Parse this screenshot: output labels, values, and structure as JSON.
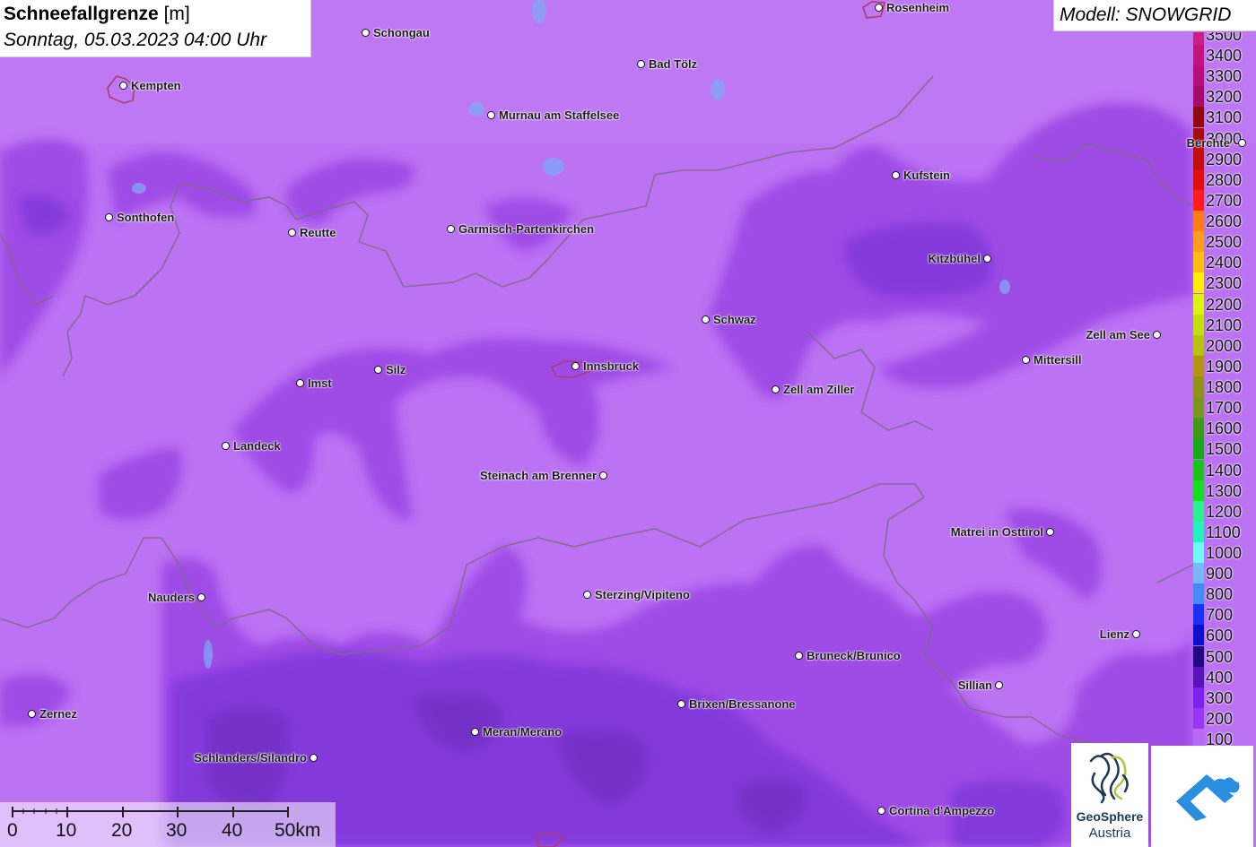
{
  "title": {
    "main": "Schneefallgrenze",
    "unit": "[m]",
    "date": "Sonntag, 05.03.2023 04:00 Uhr"
  },
  "model": "Modell: SNOWGRID",
  "legend": [
    {
      "label": "3500",
      "color": "#ca1f86"
    },
    {
      "label": "3400",
      "color": "#c4137f"
    },
    {
      "label": "3300",
      "color": "#b80e79"
    },
    {
      "label": "3200",
      "color": "#a60a6c"
    },
    {
      "label": "3100",
      "color": "#8e0a0e"
    },
    {
      "label": "3000",
      "color": "#a50c0c"
    },
    {
      "label": "2900",
      "color": "#c20e0e"
    },
    {
      "label": "2800",
      "color": "#e00f0f"
    },
    {
      "label": "2700",
      "color": "#ff1e1e"
    },
    {
      "label": "2600",
      "color": "#ff7d14"
    },
    {
      "label": "2500",
      "color": "#ff9e1a"
    },
    {
      "label": "2400",
      "color": "#ffbe0d"
    },
    {
      "label": "2300",
      "color": "#ffee00"
    },
    {
      "label": "2200",
      "color": "#dcf50f"
    },
    {
      "label": "2100",
      "color": "#c5df0c"
    },
    {
      "label": "2000",
      "color": "#b5c40a"
    },
    {
      "label": "1900",
      "color": "#b39310"
    },
    {
      "label": "1800",
      "color": "#949117"
    },
    {
      "label": "1700",
      "color": "#7c961a"
    },
    {
      "label": "1600",
      "color": "#3c9a15"
    },
    {
      "label": "1500",
      "color": "#19a81a"
    },
    {
      "label": "1400",
      "color": "#18c41a"
    },
    {
      "label": "1300",
      "color": "#14e01c"
    },
    {
      "label": "1200",
      "color": "#2af090"
    },
    {
      "label": "1100",
      "color": "#20f5bf"
    },
    {
      "label": "1000",
      "color": "#6ffaf6"
    },
    {
      "label": "900",
      "color": "#7ab9f7"
    },
    {
      "label": "800",
      "color": "#3f8cf5"
    },
    {
      "label": "700",
      "color": "#1a30f5"
    },
    {
      "label": "600",
      "color": "#0c10c9"
    },
    {
      "label": "500",
      "color": "#1d0a84"
    },
    {
      "label": "400",
      "color": "#5a12b9"
    },
    {
      "label": "300",
      "color": "#7d20f0"
    },
    {
      "label": "200",
      "color": "#9a36f5"
    },
    {
      "label": "100",
      "color": "#b76af5"
    }
  ],
  "cities": [
    {
      "name": "Rosenheim"
    },
    {
      "name": "Schongau"
    },
    {
      "name": "Kempten"
    },
    {
      "name": "Bad Tölz"
    },
    {
      "name": "Murnau am Staffelsee"
    },
    {
      "name": "Berchte"
    },
    {
      "name": "Kufstein"
    },
    {
      "name": "Sonthofen"
    },
    {
      "name": "Reutte"
    },
    {
      "name": "Garmisch-Partenkirchen"
    },
    {
      "name": "Kitzbühel"
    },
    {
      "name": "Schwaz"
    },
    {
      "name": "Zell am See"
    },
    {
      "name": "Mittersill"
    },
    {
      "name": "Silz"
    },
    {
      "name": "Innsbruck"
    },
    {
      "name": "Imst"
    },
    {
      "name": "Zell am Ziller"
    },
    {
      "name": "Landeck"
    },
    {
      "name": "Steinach am Brenner"
    },
    {
      "name": "Matrei in Osttirol"
    },
    {
      "name": "Nauders"
    },
    {
      "name": "Sterzing/Vipiteno"
    },
    {
      "name": "Lienz"
    },
    {
      "name": "Bruneck/Brunico"
    },
    {
      "name": "Sillian"
    },
    {
      "name": "Brixen/Bressanone"
    },
    {
      "name": "Zernez"
    },
    {
      "name": "Meran/Merano"
    },
    {
      "name": "Schlanders/Silandro"
    },
    {
      "name": "Cortina d'Ampezzo"
    }
  ],
  "scale": {
    "labels": [
      "0",
      "10",
      "20",
      "30",
      "40",
      "50km"
    ]
  },
  "logos": {
    "geosphere_line1": "GeoSphere",
    "geosphere_line2": "Austria"
  }
}
